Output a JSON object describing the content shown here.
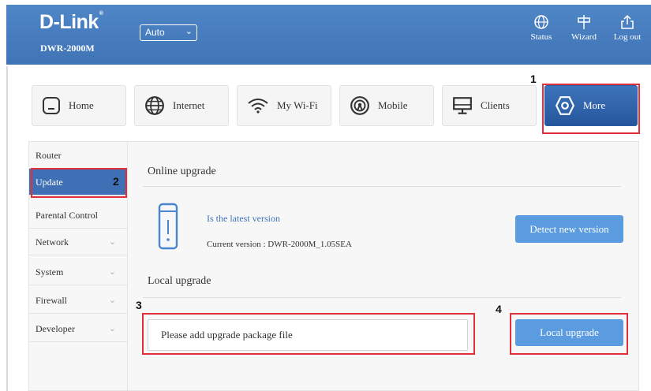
{
  "header": {
    "logo": "D-Link",
    "logo_mark": "®",
    "model": "DWR-2000M",
    "language_value": "Auto",
    "buttons": {
      "status": "Status",
      "wizard": "Wizard",
      "logout": "Log out"
    }
  },
  "tabs": [
    {
      "label": "Home",
      "icon": "home-icon"
    },
    {
      "label": "Internet",
      "icon": "globe-icon"
    },
    {
      "label": "My Wi-Fi",
      "icon": "wifi-icon"
    },
    {
      "label": "Mobile",
      "icon": "signal-icon"
    },
    {
      "label": "Clients",
      "icon": "monitor-icon"
    },
    {
      "label": "More",
      "icon": "hexagon-icon",
      "active": true
    }
  ],
  "sidebar": {
    "items": [
      {
        "label": "Router"
      },
      {
        "label": "Update",
        "active": true
      },
      {
        "label": "Parental Control"
      },
      {
        "label": "Network",
        "expandable": true
      },
      {
        "label": "System",
        "expandable": true
      },
      {
        "label": "Firewall",
        "expandable": true
      },
      {
        "label": "Developer",
        "expandable": true
      }
    ]
  },
  "main": {
    "online_title": "Online upgrade",
    "latest_status": "Is the latest version",
    "current_version": "Current version : DWR-2000M_1.05SEA",
    "detect_button": "Detect new version",
    "local_title": "Local upgrade",
    "file_placeholder": "Please add upgrade package file",
    "local_button": "Local upgrade"
  },
  "annotations": {
    "n1": "1",
    "n2": "2",
    "n3": "3",
    "n4": "4"
  },
  "colors": {
    "header": "#3f74b6",
    "accent": "#5b9be0",
    "highlight": "#e0303a",
    "active_tab": "#25569b"
  }
}
